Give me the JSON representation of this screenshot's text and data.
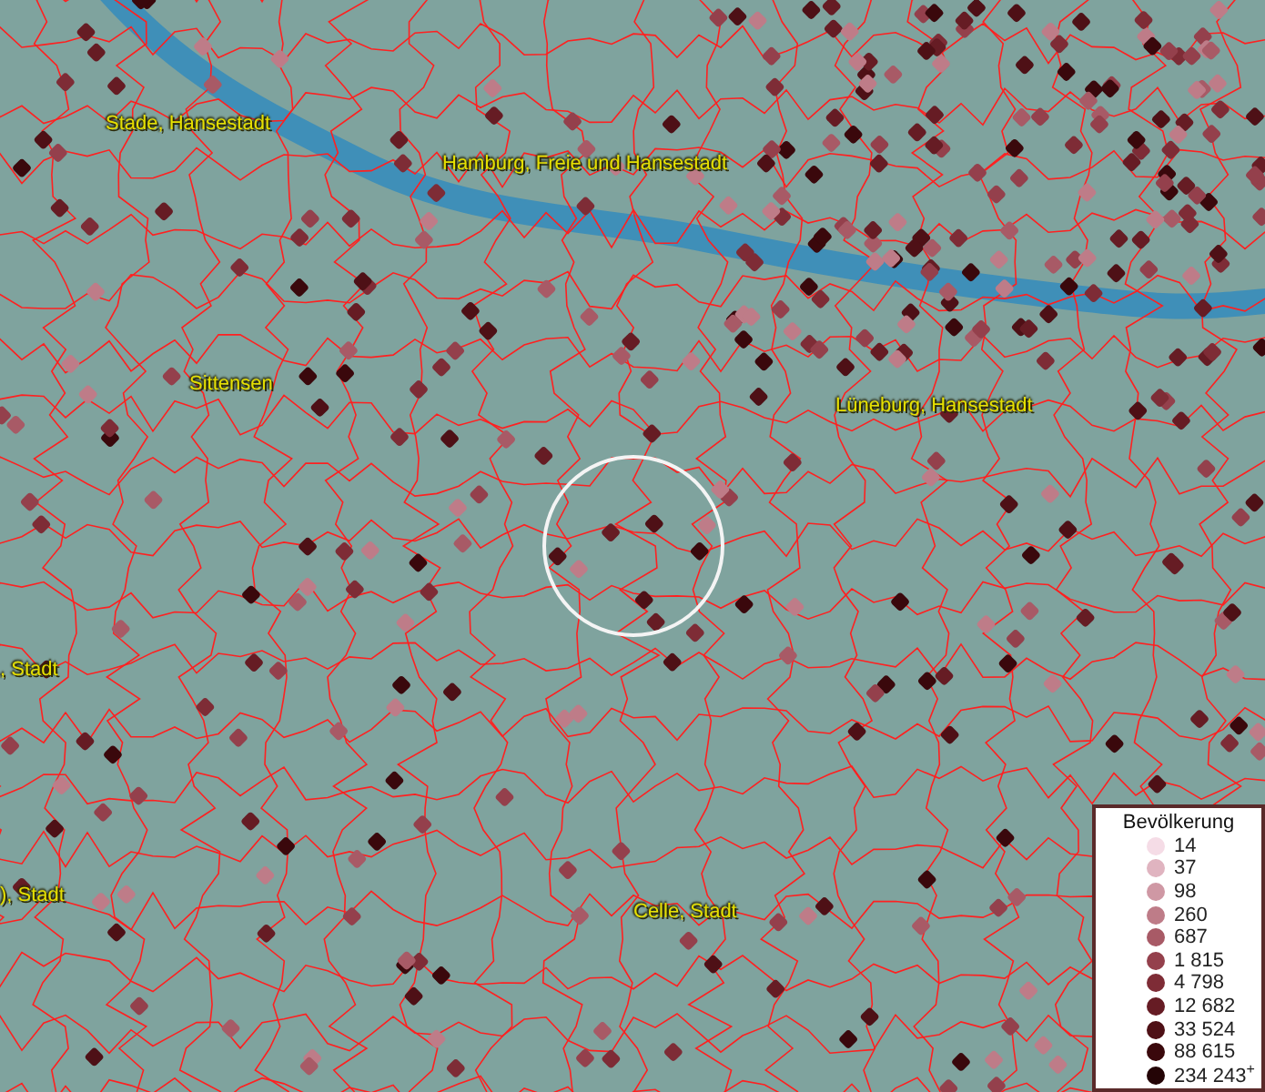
{
  "map": {
    "places": [
      {
        "name": "Stade, Hansestadt"
      },
      {
        "name": "Hamburg, Freie und Hansestadt"
      },
      {
        "name": "Sittensen"
      },
      {
        "name": "Lüneburg, Hansestadt"
      },
      {
        "name": ", Stadt"
      },
      {
        "name": "), Stadt"
      },
      {
        "name": "Celle, Stadt"
      }
    ]
  },
  "legend": {
    "title": "Bevölkerung",
    "items": [
      {
        "label": "14",
        "color": "#f5dce6"
      },
      {
        "label": "37",
        "color": "#e0b4c0"
      },
      {
        "label": "98",
        "color": "#cf98a4"
      },
      {
        "label": "260",
        "color": "#be7c88"
      },
      {
        "label": "687",
        "color": "#a85a66"
      },
      {
        "label": "1 815",
        "color": "#94404c"
      },
      {
        "label": "4 798",
        "color": "#7e2c36"
      },
      {
        "label": "12 682",
        "color": "#661c24"
      },
      {
        "label": "33 524",
        "color": "#4e1016"
      },
      {
        "label": "88 615",
        "color": "#3a080c"
      },
      {
        "label": "234 243$^{+}$",
        "color": "#240406"
      }
    ]
  }
}
